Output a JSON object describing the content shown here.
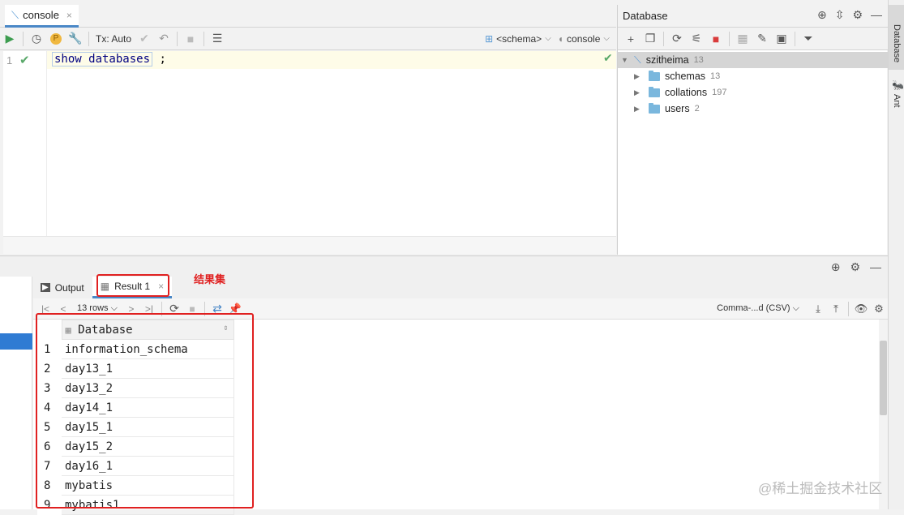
{
  "editor_tab": {
    "label": "console",
    "close": "×"
  },
  "editor_toolbar": {
    "tx_label": "Tx: Auto",
    "schema_label": "<schema>",
    "console_label": "console"
  },
  "editor": {
    "line_number": "1",
    "sql_keyword": "show databases",
    "sql_rest": " ;"
  },
  "db_panel": {
    "title": "Database",
    "root": {
      "name": "szitheima",
      "count": "13"
    },
    "children": [
      {
        "name": "schemas",
        "count": "13"
      },
      {
        "name": "collations",
        "count": "197"
      },
      {
        "name": "users",
        "count": "2"
      }
    ]
  },
  "right_strip": {
    "database": "Database",
    "ant": "Ant"
  },
  "bottom_tabs": [
    {
      "label": "Output"
    },
    {
      "label": "Result 1",
      "close": "×"
    }
  ],
  "result_toolbar": {
    "rows": "13 rows",
    "export_format": "Comma-...d (CSV)"
  },
  "result": {
    "column": "Database",
    "rows": [
      {
        "n": "1",
        "value": "information_schema"
      },
      {
        "n": "2",
        "value": "day13_1"
      },
      {
        "n": "3",
        "value": "day13_2"
      },
      {
        "n": "4",
        "value": "day14_1"
      },
      {
        "n": "5",
        "value": "day15_1"
      },
      {
        "n": "6",
        "value": "day15_2"
      },
      {
        "n": "7",
        "value": "day16_1"
      },
      {
        "n": "8",
        "value": "mybatis"
      },
      {
        "n": "9",
        "value": "mybatis1"
      }
    ]
  },
  "annotation": "结果集",
  "watermark": "@稀土掘金技术社区",
  "colors": {
    "accent": "#4a88c7",
    "annotation": "#e02020",
    "ok": "#59a869"
  }
}
